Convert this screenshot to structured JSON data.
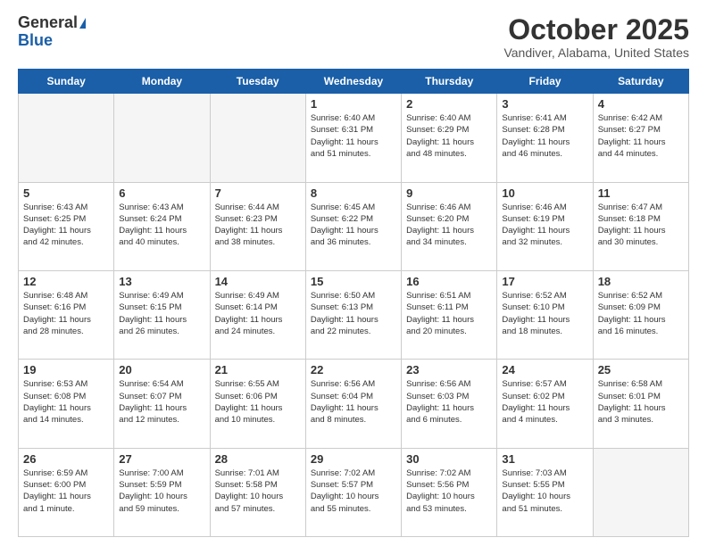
{
  "header": {
    "logo_line1": "General",
    "logo_line2": "Blue",
    "month_title": "October 2025",
    "location": "Vandiver, Alabama, United States"
  },
  "weekdays": [
    "Sunday",
    "Monday",
    "Tuesday",
    "Wednesday",
    "Thursday",
    "Friday",
    "Saturday"
  ],
  "weeks": [
    [
      {
        "day": "",
        "info": ""
      },
      {
        "day": "",
        "info": ""
      },
      {
        "day": "",
        "info": ""
      },
      {
        "day": "1",
        "info": "Sunrise: 6:40 AM\nSunset: 6:31 PM\nDaylight: 11 hours\nand 51 minutes."
      },
      {
        "day": "2",
        "info": "Sunrise: 6:40 AM\nSunset: 6:29 PM\nDaylight: 11 hours\nand 48 minutes."
      },
      {
        "day": "3",
        "info": "Sunrise: 6:41 AM\nSunset: 6:28 PM\nDaylight: 11 hours\nand 46 minutes."
      },
      {
        "day": "4",
        "info": "Sunrise: 6:42 AM\nSunset: 6:27 PM\nDaylight: 11 hours\nand 44 minutes."
      }
    ],
    [
      {
        "day": "5",
        "info": "Sunrise: 6:43 AM\nSunset: 6:25 PM\nDaylight: 11 hours\nand 42 minutes."
      },
      {
        "day": "6",
        "info": "Sunrise: 6:43 AM\nSunset: 6:24 PM\nDaylight: 11 hours\nand 40 minutes."
      },
      {
        "day": "7",
        "info": "Sunrise: 6:44 AM\nSunset: 6:23 PM\nDaylight: 11 hours\nand 38 minutes."
      },
      {
        "day": "8",
        "info": "Sunrise: 6:45 AM\nSunset: 6:22 PM\nDaylight: 11 hours\nand 36 minutes."
      },
      {
        "day": "9",
        "info": "Sunrise: 6:46 AM\nSunset: 6:20 PM\nDaylight: 11 hours\nand 34 minutes."
      },
      {
        "day": "10",
        "info": "Sunrise: 6:46 AM\nSunset: 6:19 PM\nDaylight: 11 hours\nand 32 minutes."
      },
      {
        "day": "11",
        "info": "Sunrise: 6:47 AM\nSunset: 6:18 PM\nDaylight: 11 hours\nand 30 minutes."
      }
    ],
    [
      {
        "day": "12",
        "info": "Sunrise: 6:48 AM\nSunset: 6:16 PM\nDaylight: 11 hours\nand 28 minutes."
      },
      {
        "day": "13",
        "info": "Sunrise: 6:49 AM\nSunset: 6:15 PM\nDaylight: 11 hours\nand 26 minutes."
      },
      {
        "day": "14",
        "info": "Sunrise: 6:49 AM\nSunset: 6:14 PM\nDaylight: 11 hours\nand 24 minutes."
      },
      {
        "day": "15",
        "info": "Sunrise: 6:50 AM\nSunset: 6:13 PM\nDaylight: 11 hours\nand 22 minutes."
      },
      {
        "day": "16",
        "info": "Sunrise: 6:51 AM\nSunset: 6:11 PM\nDaylight: 11 hours\nand 20 minutes."
      },
      {
        "day": "17",
        "info": "Sunrise: 6:52 AM\nSunset: 6:10 PM\nDaylight: 11 hours\nand 18 minutes."
      },
      {
        "day": "18",
        "info": "Sunrise: 6:52 AM\nSunset: 6:09 PM\nDaylight: 11 hours\nand 16 minutes."
      }
    ],
    [
      {
        "day": "19",
        "info": "Sunrise: 6:53 AM\nSunset: 6:08 PM\nDaylight: 11 hours\nand 14 minutes."
      },
      {
        "day": "20",
        "info": "Sunrise: 6:54 AM\nSunset: 6:07 PM\nDaylight: 11 hours\nand 12 minutes."
      },
      {
        "day": "21",
        "info": "Sunrise: 6:55 AM\nSunset: 6:06 PM\nDaylight: 11 hours\nand 10 minutes."
      },
      {
        "day": "22",
        "info": "Sunrise: 6:56 AM\nSunset: 6:04 PM\nDaylight: 11 hours\nand 8 minutes."
      },
      {
        "day": "23",
        "info": "Sunrise: 6:56 AM\nSunset: 6:03 PM\nDaylight: 11 hours\nand 6 minutes."
      },
      {
        "day": "24",
        "info": "Sunrise: 6:57 AM\nSunset: 6:02 PM\nDaylight: 11 hours\nand 4 minutes."
      },
      {
        "day": "25",
        "info": "Sunrise: 6:58 AM\nSunset: 6:01 PM\nDaylight: 11 hours\nand 3 minutes."
      }
    ],
    [
      {
        "day": "26",
        "info": "Sunrise: 6:59 AM\nSunset: 6:00 PM\nDaylight: 11 hours\nand 1 minute."
      },
      {
        "day": "27",
        "info": "Sunrise: 7:00 AM\nSunset: 5:59 PM\nDaylight: 10 hours\nand 59 minutes."
      },
      {
        "day": "28",
        "info": "Sunrise: 7:01 AM\nSunset: 5:58 PM\nDaylight: 10 hours\nand 57 minutes."
      },
      {
        "day": "29",
        "info": "Sunrise: 7:02 AM\nSunset: 5:57 PM\nDaylight: 10 hours\nand 55 minutes."
      },
      {
        "day": "30",
        "info": "Sunrise: 7:02 AM\nSunset: 5:56 PM\nDaylight: 10 hours\nand 53 minutes."
      },
      {
        "day": "31",
        "info": "Sunrise: 7:03 AM\nSunset: 5:55 PM\nDaylight: 10 hours\nand 51 minutes."
      },
      {
        "day": "",
        "info": ""
      }
    ]
  ]
}
